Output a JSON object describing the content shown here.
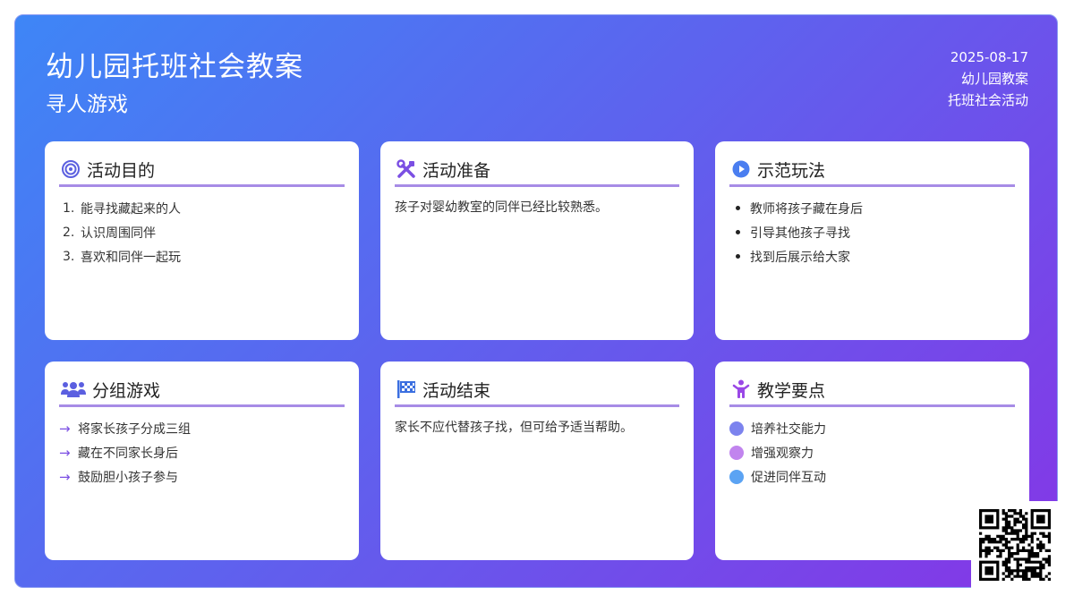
{
  "header": {
    "title": "幼儿园托班社会教案",
    "subtitle": "寻人游戏",
    "date": "2025-08-17",
    "category": "幼儿园教案",
    "type": "托班社会活动"
  },
  "cards": {
    "purpose": {
      "title": "活动目的",
      "icon": "target-icon",
      "items": [
        "能寻找藏起来的人",
        "认识周围同伴",
        "喜欢和同伴一起玩"
      ]
    },
    "prep": {
      "title": "活动准备",
      "icon": "tools-icon",
      "text": "孩子对婴幼教室的同伴已经比较熟悉。"
    },
    "demo": {
      "title": "示范玩法",
      "icon": "play-icon",
      "items": [
        "教师将孩子藏在身后",
        "引导其他孩子寻找",
        "找到后展示给大家"
      ]
    },
    "group": {
      "title": "分组游戏",
      "icon": "users-icon",
      "items": [
        "将家长孩子分成三组",
        "藏在不同家长身后",
        "鼓励胆小孩子参与"
      ]
    },
    "end": {
      "title": "活动结束",
      "icon": "flag-checkered-icon",
      "text": "家长不应代替孩子找，但可给予适当帮助。"
    },
    "points": {
      "title": "教学要点",
      "icon": "child-icon",
      "items": [
        "培养社交能力",
        "增强观察力",
        "促进同伴互动"
      ],
      "colors": [
        "#7c83ee",
        "#c184ee",
        "#5ba3f3"
      ]
    }
  },
  "colors": {
    "accent": "#7b4fe3",
    "underline": "#a78ce6",
    "gradient_start": "#3e86f6",
    "gradient_end": "#8536e6"
  }
}
